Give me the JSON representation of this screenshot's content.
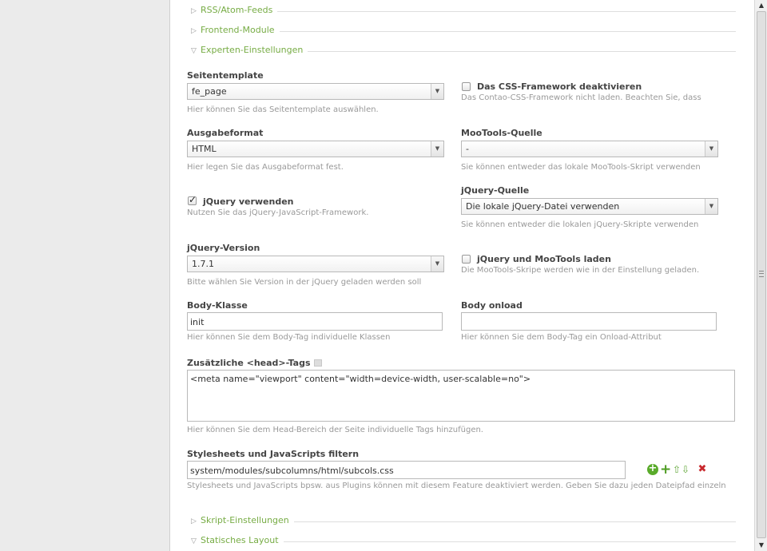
{
  "legends": {
    "rss": "RSS/Atom-Feeds",
    "frontend": "Frontend-Module",
    "expert": "Experten-Einstellungen",
    "script": "Skript-Einstellungen",
    "static": "Statisches Layout"
  },
  "icons": {
    "collapsed": "▷",
    "expanded": "▽",
    "select_arrow": "▼",
    "scroll_up": "▲",
    "scroll_down": "▼"
  },
  "seitentemplate": {
    "label": "Seitentemplate",
    "value": "fe_page",
    "hint": "Hier können Sie das Seitentemplate auswählen."
  },
  "css_framework": {
    "label": "Das CSS-Framework deaktivieren",
    "checked": false,
    "hint": "Das Contao-CSS-Framework nicht laden. Beachten Sie, dass"
  },
  "ausgabeformat": {
    "label": "Ausgabeformat",
    "value": "HTML",
    "hint": "Hier legen Sie das Ausgabeformat fest."
  },
  "mootools_quelle": {
    "label": "MooTools-Quelle",
    "value": "-",
    "hint": "Sie können entweder das lokale MooTools-Skript verwenden"
  },
  "jquery_verwenden": {
    "label": "jQuery verwenden",
    "checked": true,
    "hint": "Nutzen Sie das jQuery-JavaScript-Framework."
  },
  "jquery_quelle": {
    "label": "jQuery-Quelle",
    "value": "Die lokale jQuery-Datei verwenden",
    "hint": "Sie können entweder die lokalen jQuery-Skripte verwenden"
  },
  "jquery_version": {
    "label": "jQuery-Version",
    "value": "1.7.1",
    "hint": "Bitte wählen Sie Version in der jQuery geladen werden soll"
  },
  "jquery_mootools": {
    "label": "jQuery und MooTools laden",
    "checked": false,
    "hint": "Die MooTools-Skripe werden wie in der Einstellung geladen."
  },
  "body_klasse": {
    "label": "Body-Klasse",
    "value": "init",
    "hint": "Hier können Sie dem Body-Tag individuelle Klassen"
  },
  "body_onload": {
    "label": "Body onload",
    "value": "",
    "hint": "Hier können Sie dem Body-Tag ein Onload-Attribut"
  },
  "head_tags": {
    "label": "Zusätzliche <head>-Tags",
    "value": "<meta name=\"viewport\" content=\"width=device-width, user-scalable=no\">",
    "hint": "Hier können Sie dem Head-Bereich der Seite individuelle Tags hinzufügen."
  },
  "stylesheets_filter": {
    "label": "Stylesheets und JavaScripts filtern",
    "value": "system/modules/subcolumns/html/subcols.css",
    "hint": "Stylesheets und JavaScripts bpsw. aus Plugins können mit diesem Feature deaktiviert werden. Geben Sie dazu jeden Dateipfad einzeln"
  }
}
